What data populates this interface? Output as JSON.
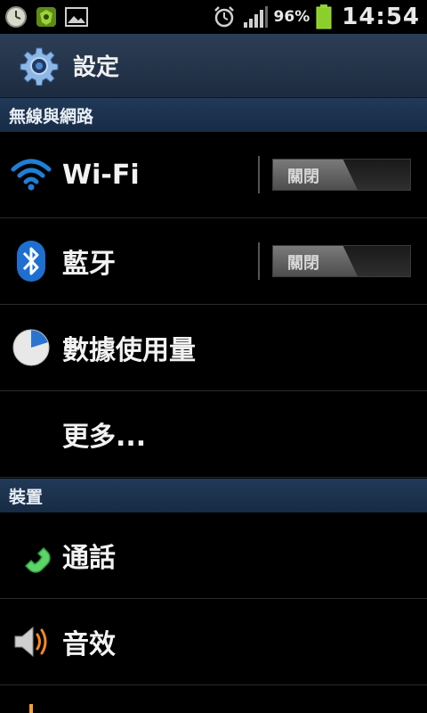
{
  "statusbar": {
    "battery_percent": "96%",
    "time": "14:54",
    "icons": [
      "clock-icon",
      "security-app-icon",
      "gallery-icon",
      "alarm-icon",
      "signal-icon",
      "battery-icon"
    ]
  },
  "titlebar": {
    "title": "設定",
    "icon": "gear-icon"
  },
  "sections": [
    {
      "header": "無線與網路"
    },
    {
      "header": "裝置"
    }
  ],
  "rows": {
    "wifi": {
      "label": "Wi-Fi",
      "toggle": "關閉",
      "icon": "wifi-icon"
    },
    "bluetooth": {
      "label": "藍牙",
      "toggle": "關閉",
      "icon": "bluetooth-icon"
    },
    "data_usage": {
      "label": "數據使用量",
      "icon": "data-usage-icon"
    },
    "more": {
      "label": "更多..."
    },
    "call": {
      "label": "通話",
      "icon": "phone-icon"
    },
    "sound": {
      "label": "音效",
      "icon": "speaker-icon"
    }
  },
  "colors": {
    "accent_blue": "#1e7fd6",
    "battery_green": "#7ed321",
    "section_bg": "#1b3150",
    "phone_green": "#5cd46a",
    "speaker_orange": "#f28a1e"
  }
}
